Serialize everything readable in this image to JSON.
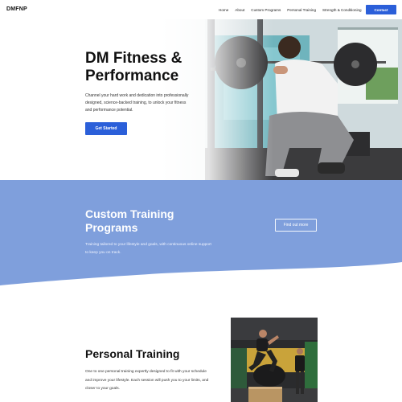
{
  "nav": {
    "logo": "DMFNP",
    "links": [
      "Home",
      "About",
      "Custom Programs",
      "Personal Training",
      "Strength & Conditioning"
    ],
    "contact_label": "Contact"
  },
  "hero": {
    "title": "DM Fitness & Performance",
    "description": "Channel your hard work and dedication into professionally designed, science-backed training, to unlock your fitness and performance potential.",
    "cta_label": "Get Started"
  },
  "custom_training": {
    "title": "Custom Training Programs",
    "description": "Training tailored to your lifestyle and goals, with continuous online support to keep you on track.",
    "cta_label": "Find out more"
  },
  "personal_training": {
    "title": "Personal Training",
    "description": "One to one personal training expertly designed to fit with your schedule and improve your lifestyle. Each session will push you to your limits, and closer to your goals."
  },
  "colors": {
    "accent": "#2b5fd9",
    "section_blue": "#7f9fdc"
  }
}
